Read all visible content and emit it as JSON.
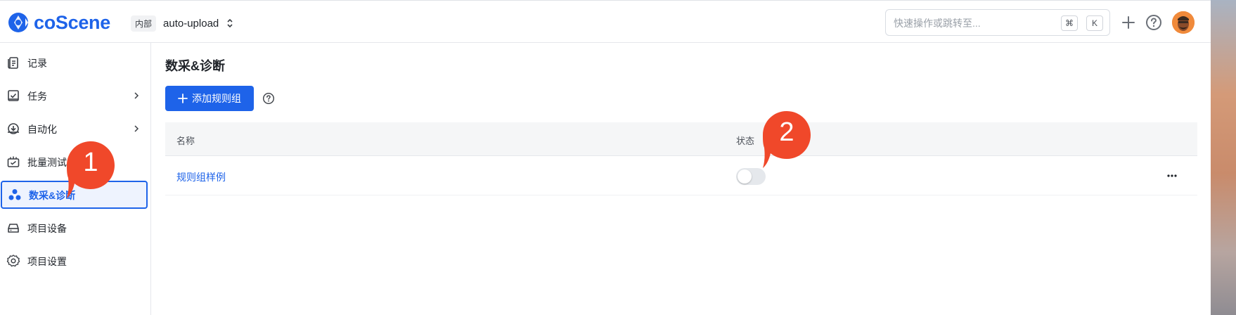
{
  "header": {
    "brand": "coScene",
    "project_badge": "内部",
    "project_name": "auto-upload",
    "search_placeholder": "快速操作或跳转至...",
    "shortcut_cmd": "⌘",
    "shortcut_key": "K"
  },
  "sidebar": {
    "items": [
      {
        "label": "记录",
        "icon": "records-icon"
      },
      {
        "label": "任务",
        "icon": "tasks-icon",
        "has_submenu": true
      },
      {
        "label": "自动化",
        "icon": "automation-icon",
        "has_submenu": true
      },
      {
        "label": "批量测试",
        "icon": "batch-test-icon"
      },
      {
        "label": "数采&诊断",
        "icon": "data-diagnosis-icon",
        "active": true
      },
      {
        "label": "项目设备",
        "icon": "devices-icon"
      },
      {
        "label": "项目设置",
        "icon": "gear-icon"
      }
    ]
  },
  "main": {
    "title": "数采&诊断",
    "add_button_label": "添加规则组",
    "table": {
      "columns": [
        "名称",
        "状态"
      ],
      "rows": [
        {
          "name": "规则组样例",
          "enabled": false
        }
      ]
    }
  },
  "annotations": {
    "one": "1",
    "two": "2"
  },
  "colors": {
    "accent": "#1e63e9",
    "callout": "#f0482a"
  }
}
